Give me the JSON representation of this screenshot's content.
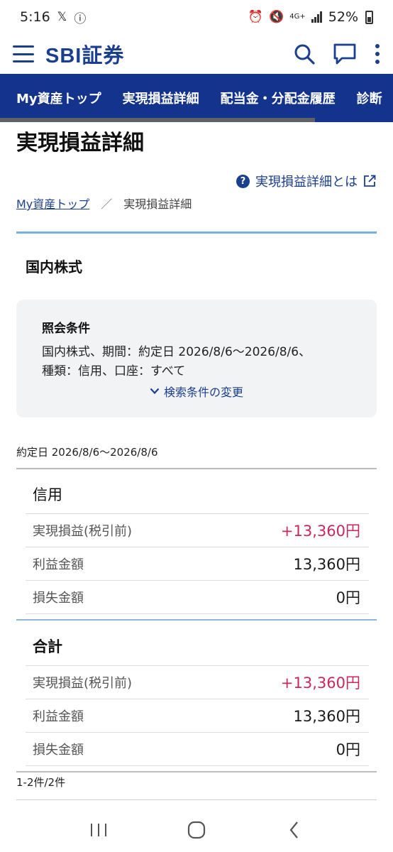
{
  "status_bar": {
    "time": "5:16",
    "battery": "52%",
    "network": "4G+"
  },
  "header": {
    "brand": "SBI証券",
    "icons": [
      "menu-icon",
      "search-icon",
      "chat-icon",
      "more-icon"
    ]
  },
  "nav": {
    "tabs": [
      "My資産トップ",
      "実現損益詳細",
      "配当金・分配金履歴",
      "診断"
    ]
  },
  "page": {
    "title": "実現損益詳細",
    "help_link": "実現損益詳細とは",
    "breadcrumb": {
      "home": "My資産トップ",
      "separator": "／",
      "current": "実現損益詳細"
    },
    "section_title": "国内株式",
    "conditions": {
      "title": "照会条件",
      "line1": "国内株式、期間：約定日 2026/8/6〜2026/8/6、",
      "line2": "種類：信用、口座：すべて",
      "change_link": "検索条件の変更"
    },
    "period": "約定日 2026/8/6〜2026/8/6",
    "groups": [
      {
        "title": "信用",
        "rows": [
          {
            "label": "実現損益(税引前)",
            "value": "+13,360円"
          },
          {
            "label": "利益金額",
            "value": "13,360円"
          },
          {
            "label": "損失金額",
            "value": "0円"
          }
        ]
      },
      {
        "title": "合計",
        "rows": [
          {
            "label": "実現損益(税引前)",
            "value": "+13,360円"
          },
          {
            "label": "利益金額",
            "value": "13,360円"
          },
          {
            "label": "損失金額",
            "value": "0円"
          }
        ]
      }
    ],
    "count": "1-2件/2件"
  },
  "colors": {
    "brand": "#1b3f8f",
    "nav_bg": "#13338c",
    "profit": "#c8285a",
    "cond_bg": "#f2f3f5"
  }
}
